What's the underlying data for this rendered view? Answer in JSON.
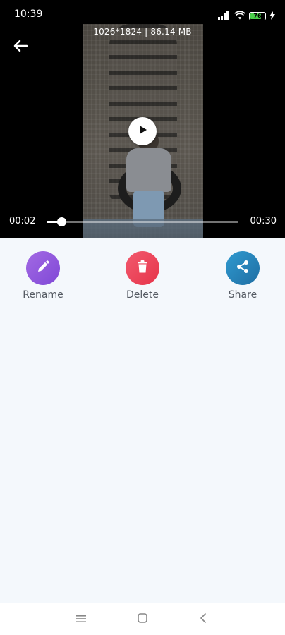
{
  "status_bar": {
    "time": "10:39",
    "battery_level": "76",
    "icons": [
      "signal-icon",
      "wifi-icon",
      "battery-icon",
      "charging-icon"
    ]
  },
  "player": {
    "info": "1026*1824 | 86.14 MB",
    "current_time": "00:02",
    "total_time": "00:30",
    "progress_fraction": 0.077
  },
  "actions": [
    {
      "label": "Rename",
      "icon": "pencil-icon",
      "color": "#8d56dd"
    },
    {
      "label": "Delete",
      "icon": "trash-icon",
      "color": "#ec4459"
    },
    {
      "label": "Share",
      "icon": "share-icon",
      "color": "#2685b9"
    }
  ],
  "nav_bar": {
    "icons": [
      "menu-icon",
      "home-icon",
      "back-icon"
    ]
  }
}
